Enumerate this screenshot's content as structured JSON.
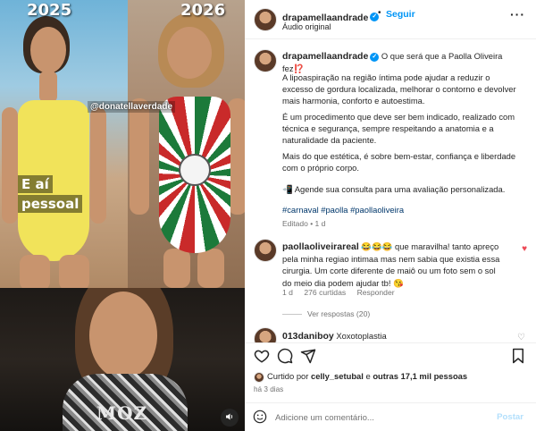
{
  "media": {
    "year_left": "2025",
    "year_right": "2026",
    "overlay_handle": "@donatellaverdade",
    "caption_line1": "E aí",
    "caption_line2": "pessoal",
    "shirt_text": "MOZ",
    "volume_icon": "speaker-icon"
  },
  "header": {
    "username": "drapamellaandrade",
    "verified_mark": "✓",
    "dot": "•",
    "follow_label": "Seguir",
    "audio_label": "Áudio original",
    "more_label": "···"
  },
  "caption": {
    "username": "drapamellaandrade",
    "first_line": "O que será que a Paolla Oliveira fez⁉️",
    "p1": "A lipoaspiração na região íntima pode ajudar a reduzir o excesso de gordura localizada, melhorar o contorno e devolver mais harmonia, conforto e autoestima.",
    "p2": "É um procedimento que deve ser bem indicado, realizado com técnica e segurança, sempre respeitando a anatomia e a naturalidade da paciente.",
    "p3": "Mais do que estética, é sobre bem-estar, confiança e liberdade com o próprio corpo.",
    "p4": "📲 Agende sua consulta para uma avaliação personalizada.",
    "hashtags": "#carnaval #paolla #paollaoliveira",
    "edited": "Editado • 1 d"
  },
  "comments": [
    {
      "username": "paollaoliveirareal",
      "text": "😂😂😂 que maravilha! tanto apreço pela minha regiao intimaa mas nem sabia que existia essa cirurgia. Um corte diferente de maiô ou um foto sem o sol do meio dia podem ajudar tb! 😘",
      "time": "1 d",
      "likes": "276 curtidas",
      "reply_label": "Responder",
      "view_replies": "Ver respostas (20)",
      "heart": "♥"
    },
    {
      "username": "013daniboy",
      "text": "Xoxotoplastia",
      "heart": "♡"
    }
  ],
  "actions": {
    "like_icon": "♡",
    "comment_icon": "◯",
    "share_icon": "➤",
    "save_icon": "⚑"
  },
  "likes": {
    "prefix": "Curtido por ",
    "user": "celly_setubal",
    "middle": " e ",
    "others": "outras 17,1 mil pessoas"
  },
  "posted_ago": "há 3 dias",
  "add_comment": {
    "emoji_icon": "☺",
    "placeholder": "Adicione um comentário...",
    "post_label": "Postar"
  }
}
